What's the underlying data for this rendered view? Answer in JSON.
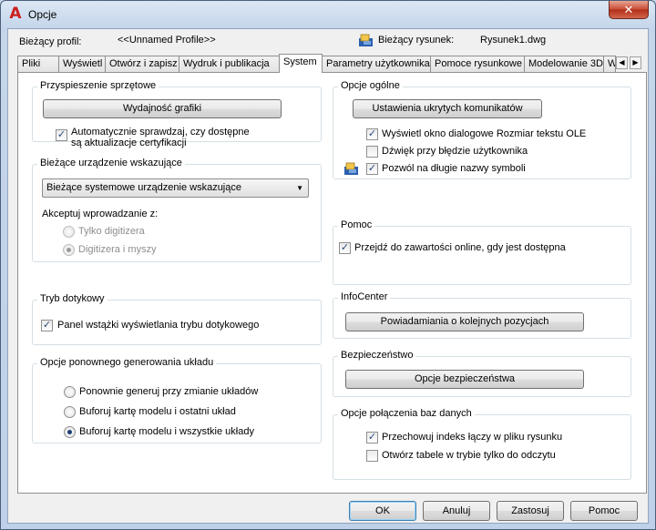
{
  "window": {
    "title": "Opcje",
    "close_symbol": "✕"
  },
  "header": {
    "profile_label": "Bieżący profil:",
    "profile_value": "<<Unnamed Profile>>",
    "drawing_label": "Bieżący rysunek:",
    "drawing_value": "Rysunek1.dwg"
  },
  "tabs": [
    {
      "label": "Pliki"
    },
    {
      "label": "Wyświetl"
    },
    {
      "label": "Otwórz i zapisz"
    },
    {
      "label": "Wydruk i publikacja"
    },
    {
      "label": "System",
      "active": true
    },
    {
      "label": "Parametry użytkownika"
    },
    {
      "label": "Pomoce rysunkowe"
    },
    {
      "label": "Modelowanie 3D"
    },
    {
      "label": "W"
    }
  ],
  "tab_scroll": {
    "left": "◀",
    "right": "▶"
  },
  "hardware": {
    "title": "Przyspieszenie sprzętowe",
    "button": "Wydajność grafiki",
    "auto_check_line1": "Automatycznie sprawdzaj, czy dostępne",
    "auto_check_line2": "są aktualizacje certyfikacji",
    "auto_check_checked": true
  },
  "pointing": {
    "title": "Bieżące urządzenie wskazujące",
    "selected": "Bieżące systemowe urządzenie wskazujące",
    "accept_label": "Akceptuj wprowadzanie z:",
    "options": [
      {
        "label": "Tylko digitizera",
        "checked": false
      },
      {
        "label": "Digitizera i myszy",
        "checked": true
      }
    ]
  },
  "touch": {
    "title": "Tryb dotykowy",
    "panel_label": "Panel wstążki wyświetlania trybu dotykowego",
    "panel_checked": true
  },
  "regen": {
    "title": "Opcje ponownego generowania układu",
    "options": [
      {
        "label": "Ponownie generuj przy zmianie układów",
        "checked": false
      },
      {
        "label": "Buforuj kartę modelu i ostatni układ",
        "checked": false
      },
      {
        "label": "Buforuj kartę modelu i wszystkie układy",
        "checked": true
      }
    ]
  },
  "general": {
    "title": "Opcje ogólne",
    "button": "Ustawienia ukrytych komunikatów",
    "options": [
      {
        "label": "Wyświetl okno dialogowe Rozmiar tekstu OLE",
        "checked": true
      },
      {
        "label": "Dźwięk przy błędzie użytkownika",
        "checked": false
      },
      {
        "label": "Pozwól na długie nazwy symboli",
        "checked": true
      }
    ]
  },
  "help": {
    "title": "Pomoc",
    "online_label": "Przejdź do zawartości online, gdy jest dostępna",
    "online_checked": true
  },
  "infocenter": {
    "title": "InfoCenter",
    "button": "Powiadamiania o kolejnych pozycjach"
  },
  "security": {
    "title": "Bezpieczeństwo",
    "button": "Opcje bezpieczeństwa"
  },
  "db": {
    "title": "Opcje połączenia baz danych",
    "options": [
      {
        "label": "Przechowuj indeks łączy w pliku rysunku",
        "checked": true
      },
      {
        "label": "Otwórz tabele w trybie tylko do odczytu",
        "checked": false
      }
    ]
  },
  "footer": {
    "ok": "OK",
    "cancel": "Anuluj",
    "apply": "Zastosuj",
    "help": "Pomoc"
  },
  "check_glyph": "✓"
}
